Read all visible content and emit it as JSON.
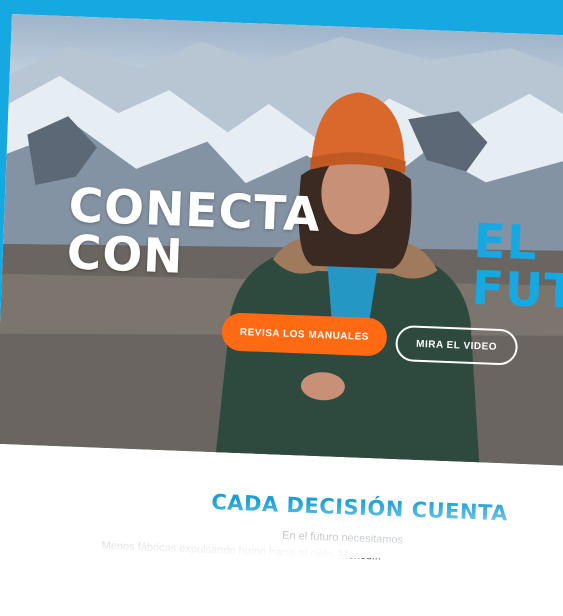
{
  "hero": {
    "headline_line1": "CONECTA",
    "headline_line2": "CON",
    "accent_line1": "EL",
    "accent_line2": "FUT",
    "primary_button": "REVISA LOS MANUALES",
    "secondary_button": "MIRA EL VIDEO"
  },
  "section": {
    "title": "CADA DECISIÓN CUENTA",
    "line1": "En el futuro necesitamos",
    "line2": "Menos fábricas expulsando humo hacia el cielo. Menos..."
  },
  "colors": {
    "accent_blue": "#16a9e1",
    "cta_orange": "#ff6a13",
    "title_blue": "#1a9fd6"
  }
}
